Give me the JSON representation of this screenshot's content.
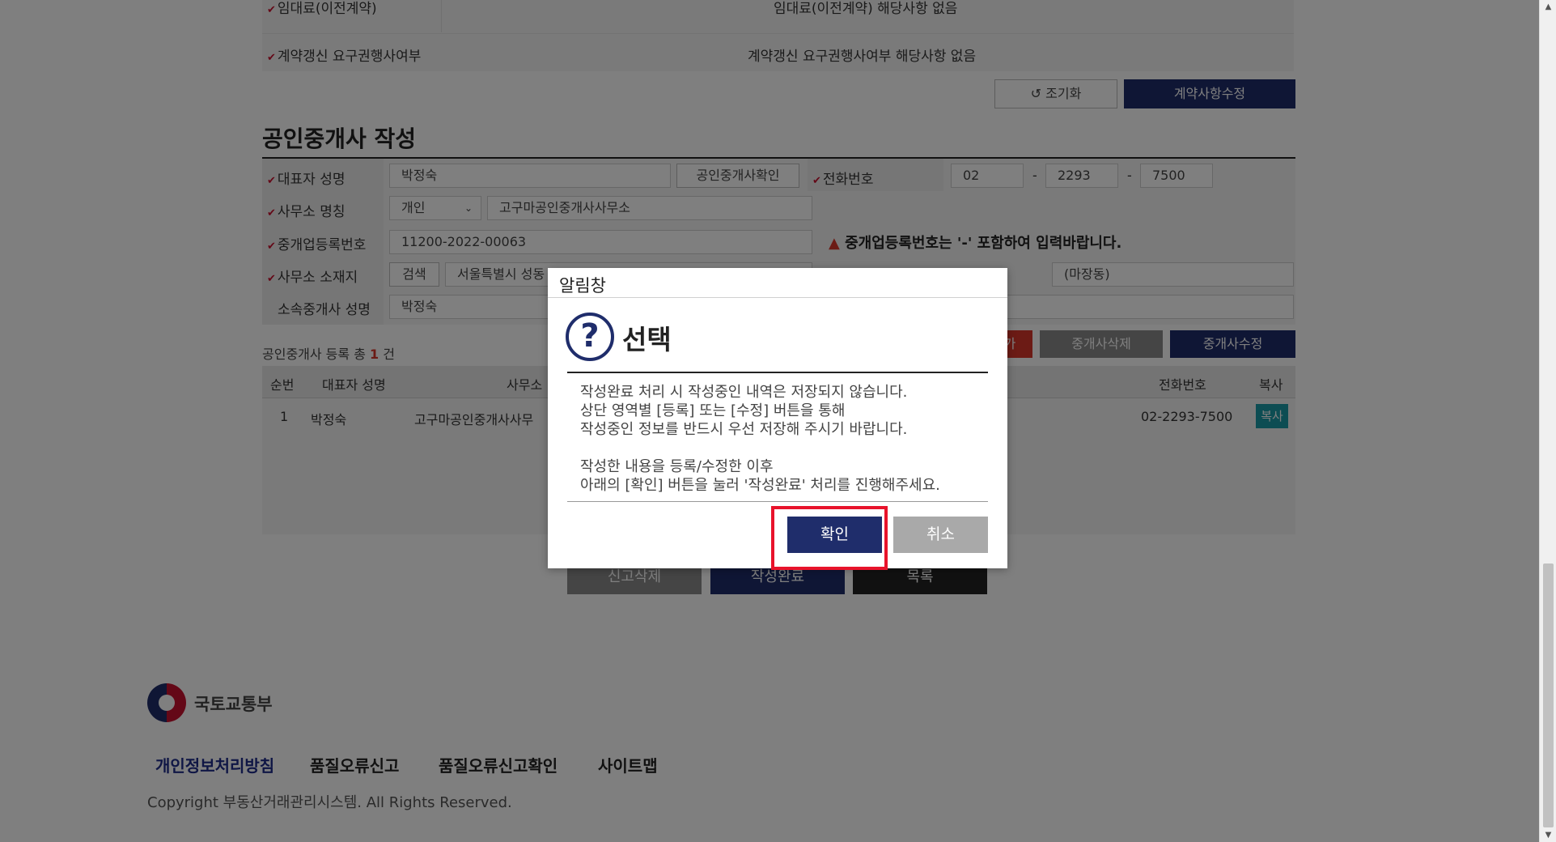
{
  "top": {
    "row1_label": "임대료(이전계약)",
    "row1_value": "임대료(이전계약) 해당사항 없음",
    "row2_label": "계약갱신 요구권행사여부",
    "row2_value": "계약갱신 요구권행사여부 해당사항 없음",
    "reset_label": "조기화",
    "edit_contract_label": "계약사항수정"
  },
  "section": {
    "title": "공인중개사 작성",
    "rep_name_label": "대표자 성명",
    "rep_name_value": "박정숙",
    "verify_btn": "공인중개사확인",
    "phone_label": "전화번호",
    "phone1": "02",
    "phone2": "2293",
    "phone3": "7500",
    "phone_sep": "-",
    "office_name_label": "사무소 명칭",
    "office_type": "개인",
    "office_name_value": "고구마공인중개사사무소",
    "reg_no_label": "중개업등록번호",
    "reg_no_value": "11200-2022-00063",
    "reg_warning": "중개업등록번호는 '-' 포함하여 입력바랍니다.",
    "office_addr_label": "사무소 소재지",
    "search_btn": "검색",
    "addr_value": "서울특별시 성동",
    "addr_dong": "(마장동)",
    "agent_name_label": "소속중개사 성명",
    "agent_name_value": "박정숙",
    "add_btn_partial": "가",
    "delete_agent_btn": "중개사삭제",
    "edit_agent_btn": "중개사수정",
    "count_prefix": "공인중개사 등록 총",
    "count_value": "1",
    "count_suffix": "건"
  },
  "table": {
    "headers": [
      "순번",
      "대표자 성명",
      "사무소",
      "전화번호",
      "복사"
    ],
    "rows": [
      {
        "no": "1",
        "name": "박정숙",
        "office": "고구마공인중개사사무",
        "phone": "02-2293-7500",
        "copy": "복사"
      }
    ]
  },
  "bottom_buttons": {
    "delete_report": "신고삭제",
    "complete": "작성완료",
    "list": "목록"
  },
  "footer": {
    "ministry": "국토교통부",
    "links": [
      "개인정보처리방침",
      "품질오류신고",
      "품질오류신고확인",
      "사이트맵"
    ],
    "copyright": "Copyright 부동산거래관리시스템. All Rights Reserved."
  },
  "modal": {
    "title": "알림창",
    "heading": "선택",
    "message": "작성완료 처리 시 작성중인 내역은 저장되지 않습니다.\n상단 영역별 [등록] 또는 [수정] 버튼을 통해\n작성중인 정보를 반드시 우선 저장해 주시기 바랍니다.\n\n작성한 내용을 등록/수정한 이후\n아래의 [확인] 버튼을 눌러 '작성완료' 처리를 진행해주세요.",
    "confirm": "확인",
    "cancel": "취소"
  },
  "colors": {
    "navy": "#1f2d6b",
    "highlight": "#e8132b",
    "required": "#c8102e",
    "teal": "#1b9aa6"
  }
}
